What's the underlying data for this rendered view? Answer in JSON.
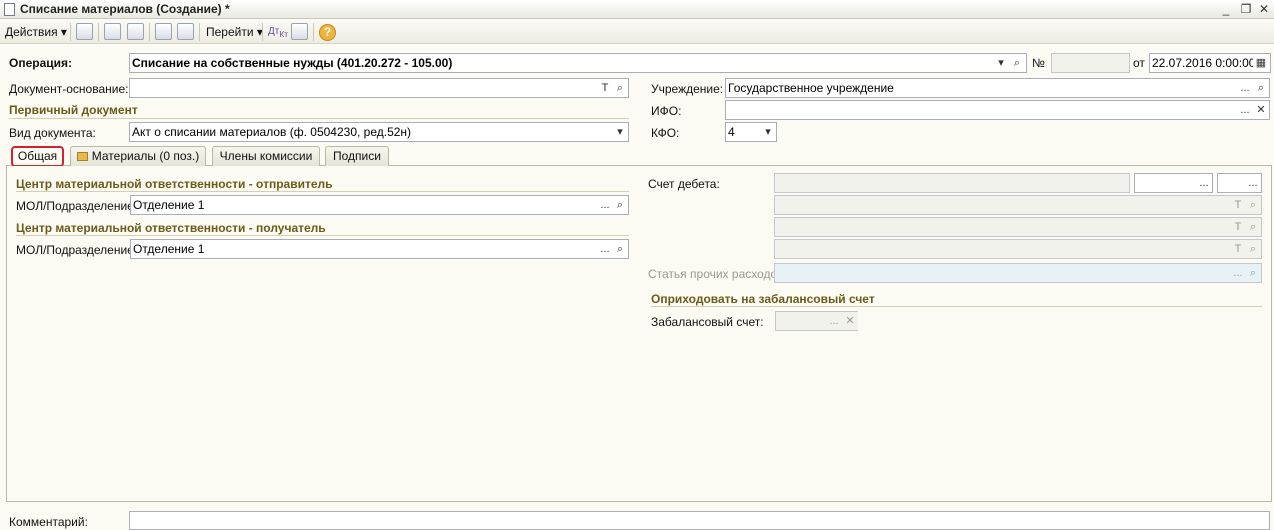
{
  "window": {
    "title": "Списание материалов (Создание) *",
    "controls": {
      "minimize": "_",
      "restore": "❐",
      "close": "✕"
    }
  },
  "toolbar": {
    "actions_label": "Действия",
    "goto_label": "Перейти",
    "help_icon": "?"
  },
  "header": {
    "operation_label": "Операция:",
    "operation_value": "Списание на собственные нужды (401.20.272 - 105.00)",
    "number_label": "№",
    "number_value": "",
    "date_label": "от",
    "date_value": "22.07.2016  0:00:00",
    "base_doc_label": "Документ-основание:",
    "base_doc_value": "",
    "institution_label": "Учреждение:",
    "institution_value": "Государственное учреждение",
    "primary_doc_section": "Первичный документ",
    "ifo_label": "ИФО:",
    "ifo_value": "",
    "doc_type_label": "Вид документа:",
    "doc_type_value": "Акт о списании материалов (ф. 0504230, ред.52н)",
    "kfo_label": "КФО:",
    "kfo_value": "4"
  },
  "tabs": [
    {
      "label": "Общая"
    },
    {
      "label": "Материалы (0 поз.)"
    },
    {
      "label": "Члены комиссии"
    },
    {
      "label": "Подписи"
    }
  ],
  "general": {
    "sender_section": "Центр материальной ответственности - отправитель",
    "sender_mol_label": "МОЛ/Подразделение:",
    "sender_mol_value": "Отделение 1",
    "receiver_section": "Центр материальной ответственности - получатель",
    "receiver_mol_label": "МОЛ/Подразделение",
    "receiver_mol_value": "Отделение 1",
    "debit_account_label": "Счет дебета:",
    "other_expenses_label": "Статья прочих расходов:",
    "offbalance_section": "Оприходовать на забалансовый счет",
    "offbalance_account_label": "Забалансовый счет:",
    "offbalance_account_value": ""
  },
  "footer": {
    "comment_label": "Комментарий:",
    "comment_value": ""
  },
  "glyphs": {
    "ellipsis": "...",
    "text_t": "T",
    "dropdown": "▾",
    "clear": "✕",
    "calendar": "▦"
  },
  "colors": {
    "section_text": "#6b5a1a",
    "tab_highlight": "#d0232a",
    "disabled_field": "#e7f2f6"
  }
}
